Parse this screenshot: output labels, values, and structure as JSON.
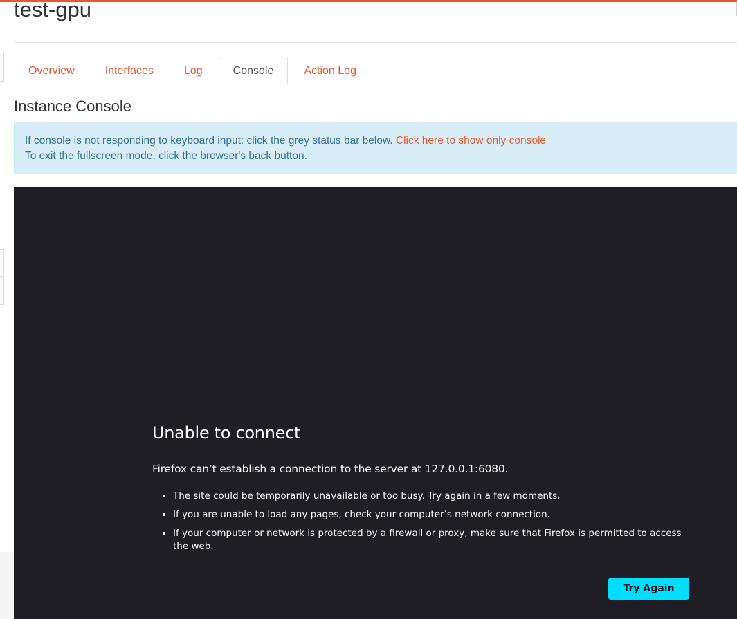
{
  "header": {
    "title": "test-gpu"
  },
  "tabs": [
    {
      "label": "Overview",
      "active": false
    },
    {
      "label": "Interfaces",
      "active": false
    },
    {
      "label": "Log",
      "active": false
    },
    {
      "label": "Console",
      "active": true
    },
    {
      "label": "Action Log",
      "active": false
    }
  ],
  "main": {
    "section_title": "Instance Console",
    "alert": {
      "line1": "If console is not responding to keyboard input: click the grey status bar below.",
      "link": "Click here to show only console",
      "line2": "To exit the fullscreen mode, click the browser's back button."
    }
  },
  "console": {
    "error_title": "Unable to connect",
    "error_message": "Firefox can’t establish a connection to the server at 127.0.0.1:6080.",
    "bullets": [
      "The site could be temporarily unavailable or too busy. Try again in a few moments.",
      "If you are unable to load any pages, check your computer’s network connection.",
      "If your computer or network is protected by a firewall or proxy, make sure that Firefox is permitted to access the web."
    ],
    "try_again_label": "Try Again"
  },
  "colors": {
    "accent": "#e8582c",
    "alert_bg": "#d9edf7",
    "alert_text": "#31708f",
    "console_bg": "#1f1e24",
    "button_bg": "#00ddff"
  }
}
